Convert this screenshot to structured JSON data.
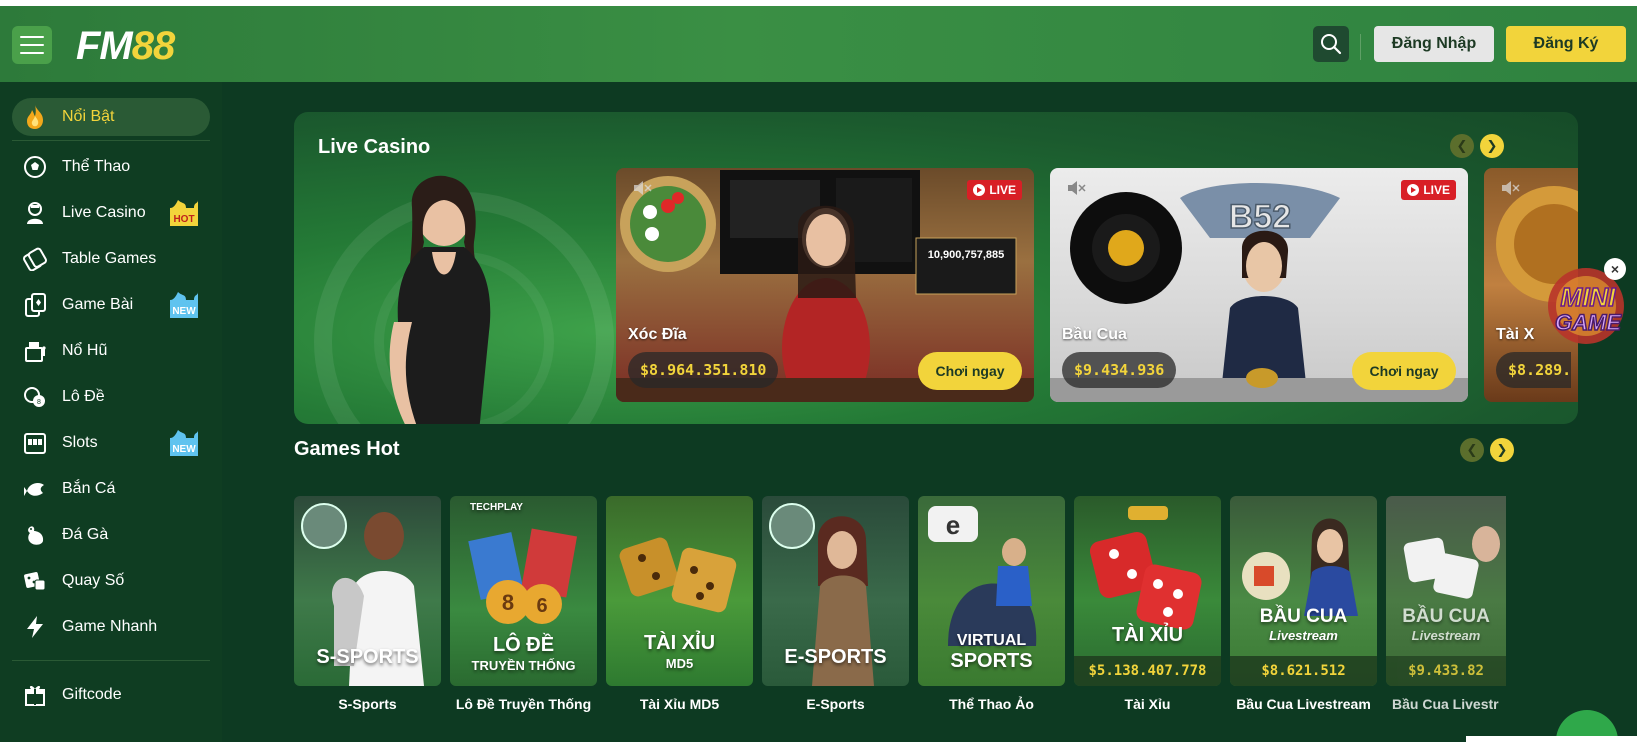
{
  "header": {
    "logo_fm": "FM",
    "logo_88": "88",
    "login_label": "Đăng Nhập",
    "register_label": "Đăng Ký"
  },
  "sidebar": {
    "items": [
      {
        "label": "Nổi Bật",
        "icon": "fire-icon"
      },
      {
        "label": "Thể Thao",
        "icon": "soccer-ball-icon"
      },
      {
        "label": "Live Casino",
        "icon": "dealer-icon",
        "badge": "HOT"
      },
      {
        "label": "Table Games",
        "icon": "chips-icon"
      },
      {
        "label": "Game Bài",
        "icon": "cards-icon",
        "badge": "NEW"
      },
      {
        "label": "Nổ Hũ",
        "icon": "jackpot-machine-icon"
      },
      {
        "label": "Lô Đề",
        "icon": "lottery-balls-icon"
      },
      {
        "label": "Slots",
        "icon": "slot-machine-icon",
        "badge": "NEW"
      },
      {
        "label": "Bắn Cá",
        "icon": "fish-icon"
      },
      {
        "label": "Đá Gà",
        "icon": "rooster-icon"
      },
      {
        "label": "Quay Số",
        "icon": "dice-icon"
      },
      {
        "label": "Game Nhanh",
        "icon": "lightning-icon"
      },
      {
        "label": "Giftcode",
        "icon": "gift-icon"
      }
    ]
  },
  "live_casino": {
    "title": "Live Casino",
    "live_label": "LIVE",
    "play_label": "Chơi ngay",
    "cards": [
      {
        "name": "Xóc Đĩa",
        "jackpot": "$8.964.351.810"
      },
      {
        "name": "Bầu Cua",
        "jackpot": "$9.434.936"
      },
      {
        "name": "Tài X",
        "jackpot": "$8.289."
      }
    ],
    "xoc_dia_screen_value": "10,900,757,885",
    "b52_logo": "B52"
  },
  "games_hot": {
    "title": "Games Hot",
    "games": [
      {
        "label": "S-Sports",
        "art_text": "S-SPORTS"
      },
      {
        "label": "Lô Đề Truyền Thống",
        "art_text": "LÔ ĐỀ",
        "art_sub": "TRUYỀN THỐNG",
        "art_brand": "TECHPLAY"
      },
      {
        "label": "Tài Xỉu MD5",
        "art_text": "TÀI XỈU",
        "art_sub": "MD5"
      },
      {
        "label": "E-Sports",
        "art_text": "E-SPORTS"
      },
      {
        "label": "Thể Thao Ảo",
        "art_text": "VIRTUAL",
        "art_sub": "SPORTS"
      },
      {
        "label": "Tài Xỉu",
        "art_text": "TÀI XỈU",
        "jackpot": "$5.138.407.778"
      },
      {
        "label": "Bầu Cua Livestream",
        "art_text": "BẦU CUA",
        "art_sub": "Livestream",
        "jackpot": "$8.621.512"
      },
      {
        "label": "Bầu Cua Livestr",
        "art_text": "BẦU CUA",
        "art_sub": "Livestream",
        "jackpot": "$9.433.82"
      }
    ]
  },
  "mini_game": {
    "label_top": "MINI",
    "label_bottom": "GAME"
  },
  "colors": {
    "accent_yellow": "#f2d43b",
    "header_green": "#3a8f44",
    "bg_dark_green": "#0d3a22",
    "live_red": "#d81f26"
  }
}
